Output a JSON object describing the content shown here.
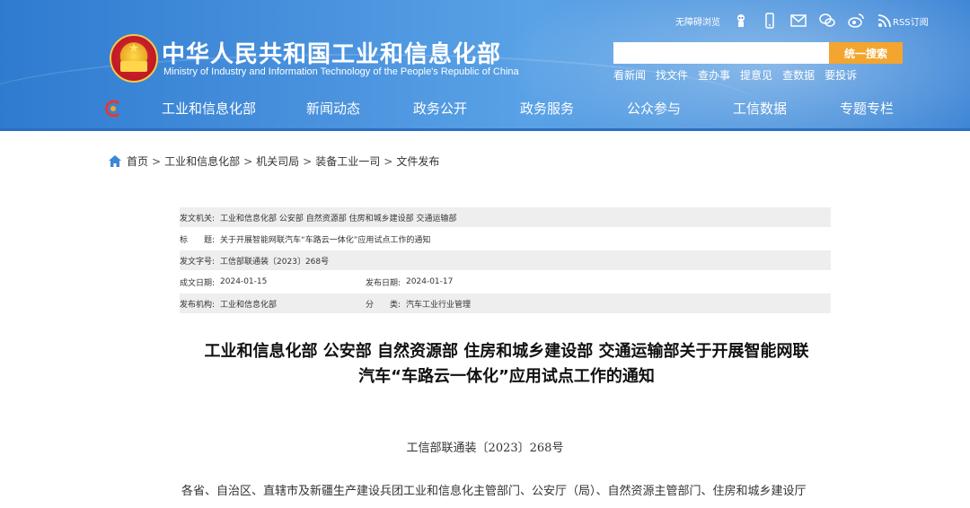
{
  "header": {
    "title_cn": "中华人民共和国工业和信息化部",
    "title_en": "Ministry of Industry and Information Technology of the People's Republic of China",
    "toolbar": {
      "accessible_label": "无障碍浏览",
      "rss_label": "RSS订阅",
      "icons": [
        "accessibility-robot-icon",
        "mobile-icon",
        "mail-icon",
        "wechat-icon",
        "weibo-icon",
        "rss-icon"
      ]
    },
    "search": {
      "placeholder": "",
      "button_label": "统一搜索"
    },
    "quick_links": [
      "看新闻",
      "找文件",
      "查办事",
      "提意见",
      "查数据",
      "要投诉"
    ],
    "nav": [
      "工业和信息化部",
      "新闻动态",
      "政务公开",
      "政务服务",
      "公众参与",
      "工信数据",
      "专题专栏"
    ],
    "colors": {
      "banner": "#3e86d6",
      "search_button": "#f3a52f"
    }
  },
  "breadcrumb": [
    "首页",
    "工业和信息化部",
    "机关司局",
    "装备工业一司",
    "文件发布"
  ],
  "meta": {
    "issuer_label": "发文机关:",
    "issuer": "工业和信息化部 公安部 自然资源部 住房和城乡建设部 交通运输部",
    "title_label": "标　　题:",
    "title": "关于开展智能网联汽车“车路云一体化”应用试点工作的通知",
    "docno_label": "发文字号:",
    "docno": "工信部联通装〔2023〕268号",
    "created_label": "成文日期:",
    "created": "2024-01-15",
    "published_label": "发布日期:",
    "published": "2024-01-17",
    "org_label": "发布机构:",
    "org": "工业和信息化部",
    "category_label": "分　　类:",
    "category": "汽车工业行业管理"
  },
  "document": {
    "title_line1": "工业和信息化部 公安部 自然资源部 住房和城乡建设部 交通运输部关于开展智能网联",
    "title_line2": "汽车“车路云一体化”应用试点工作的通知",
    "number": "工信部联通装〔2023〕268号",
    "body_line1": "各省、自治区、直辖市及新疆生产建设兵团工业和信息化主管部门、公安厅（局）、自然资源主管部门、住房和城乡建设厅"
  }
}
